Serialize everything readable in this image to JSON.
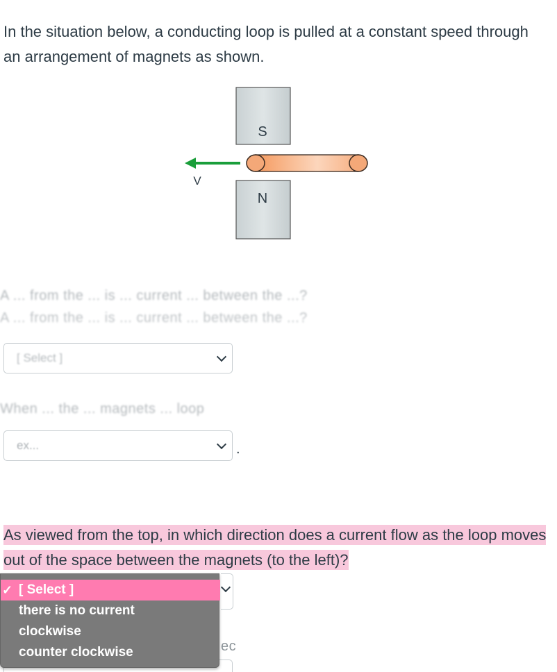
{
  "intro": {
    "text": "In the situation below, a conducting loop is pulled at a constant speed through an arrangement of magnets as shown."
  },
  "figure": {
    "top_magnet_label": "S",
    "bottom_magnet_label": "N",
    "velocity_label": "V",
    "arrow_color": "#1a9e3a",
    "loop_color": "#f4a878"
  },
  "question1": {
    "text_fragment": "A ... from the ... is ... current ... between the ...?",
    "select_value": "[ Select ]"
  },
  "question2": {
    "text_fragment": "When ... the ... magnets ... loop",
    "select_value": "ex...",
    "select_tail": "..."
  },
  "question3": {
    "text": "As viewed from the top, in which direction does a current flow as the loop moves out of the space between the magnets (to the left)?",
    "trailing_fragment": "ec"
  },
  "dropdown": {
    "options": [
      {
        "label": "[ Select ]",
        "selected": true
      },
      {
        "label": "there is no current",
        "selected": false
      },
      {
        "label": "clockwise",
        "selected": false
      },
      {
        "label": "counter clockwise",
        "selected": false
      }
    ]
  },
  "colors": {
    "highlight": "#f8c8dc",
    "selected_option": "#ff7bb0",
    "dropdown_bg": "#7a7a7a"
  }
}
